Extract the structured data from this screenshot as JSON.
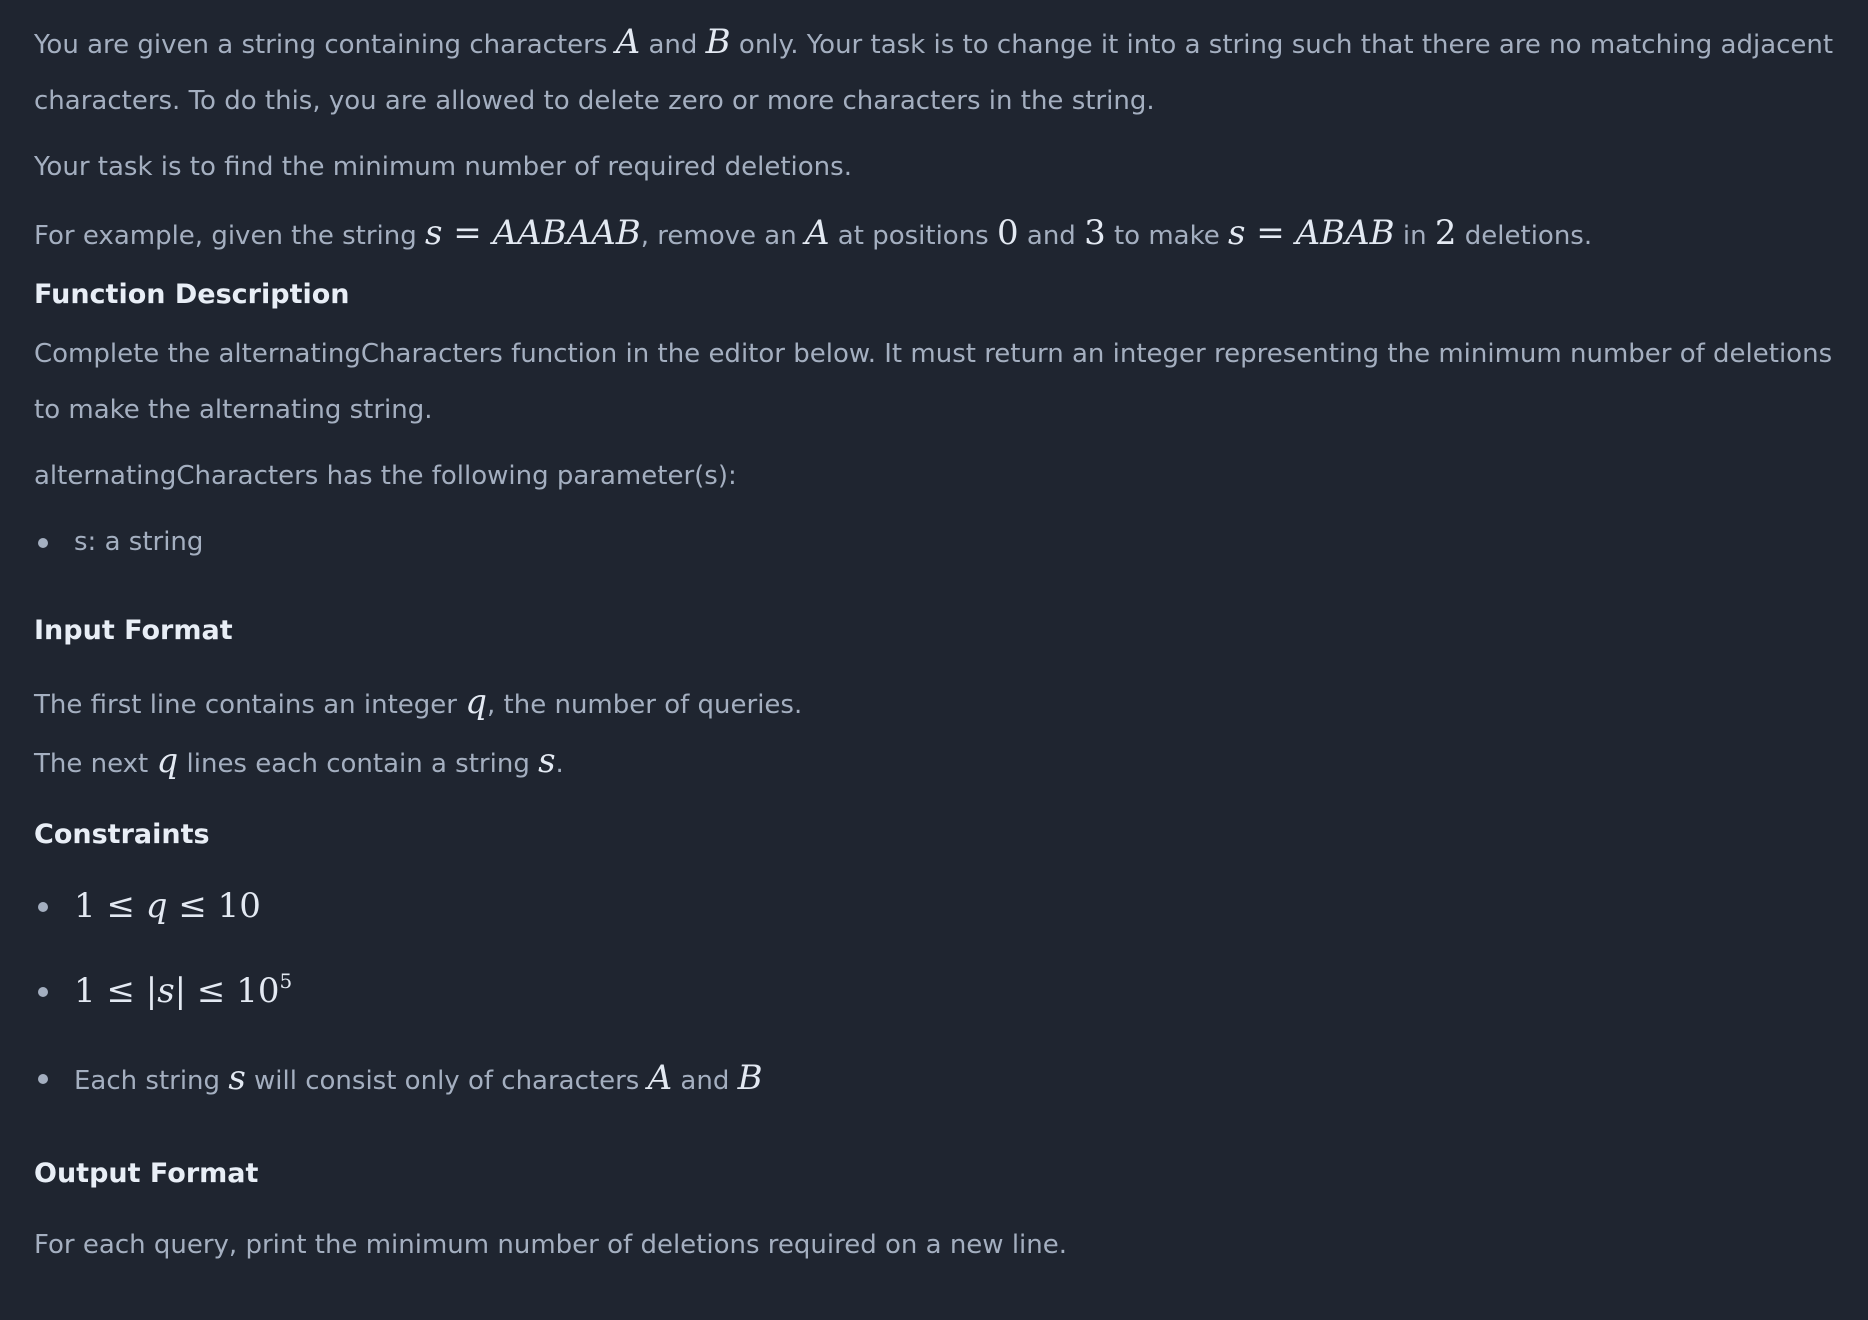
{
  "intro": {
    "p1_a": "You are given a string containing characters ",
    "p1_var_a": "A",
    "p1_b": " and ",
    "p1_var_b": "B",
    "p1_c": " only. Your task is to change it into a string such that there are no matching adjacent characters. To do this, you are allowed to delete zero or more characters in the string.",
    "p2": "Your task is to find the minimum number of required deletions.",
    "p3_a": "For example, given the string ",
    "p3_s1": "s",
    "p3_eq1": " = ",
    "p3_str1": "AABAAB",
    "p3_b": ", remove an ",
    "p3_var_a": "A",
    "p3_c": " at positions ",
    "p3_pos0": "0",
    "p3_d": " and ",
    "p3_pos3": "3",
    "p3_e": " to make ",
    "p3_s2": "s",
    "p3_eq2": " = ",
    "p3_str2": "ABAB",
    "p3_f": " in ",
    "p3_num2": "2",
    "p3_g": " deletions."
  },
  "function_description": {
    "heading": "Function Description",
    "p1": "Complete the alternatingCharacters function in the editor below. It must return an integer representing the minimum number of deletions to make the alternating string.",
    "p2": "alternatingCharacters has the following parameter(s):",
    "params": [
      "s: a string"
    ]
  },
  "input_format": {
    "heading": "Input Format",
    "l1_a": "The first line contains an integer ",
    "l1_var": "q",
    "l1_b": ", the number of queries.",
    "l2_a": "The next ",
    "l2_var": "q",
    "l2_b": " lines each contain a string ",
    "l2_var2": "s",
    "l2_c": "."
  },
  "constraints": {
    "heading": "Constraints",
    "c1_1": "1",
    "c1_le1": " ≤ ",
    "c1_q": "q",
    "c1_le2": " ≤ ",
    "c1_10": "10",
    "c2_1": "1",
    "c2_le1": " ≤ ",
    "c2_abs": "|s|",
    "c2_le2": " ≤ ",
    "c2_10": "10",
    "c2_exp": "5",
    "c3_a": "Each string ",
    "c3_s": "s",
    "c3_b": " will consist only of characters ",
    "c3_A": "A",
    "c3_and": " and ",
    "c3_B": "B"
  },
  "output_format": {
    "heading": "Output Format",
    "p1": "For each query, print the minimum number of deletions required on a new line."
  }
}
